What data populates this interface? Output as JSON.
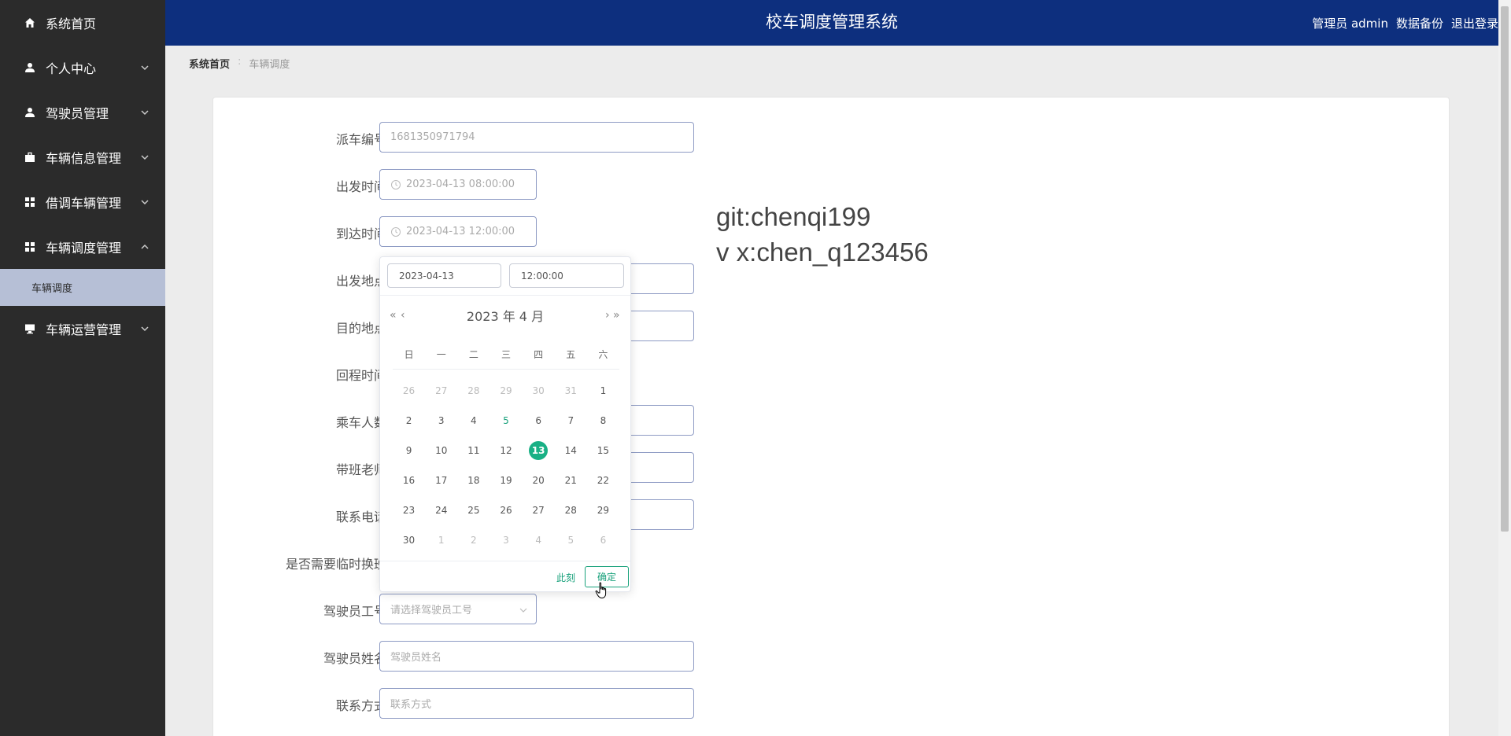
{
  "sidebar": {
    "items": [
      {
        "label": "系统首页",
        "icon": "home-icon"
      },
      {
        "label": "个人中心",
        "icon": "user-icon"
      },
      {
        "label": "驾驶员管理",
        "icon": "user-icon"
      },
      {
        "label": "车辆信息管理",
        "icon": "briefcase-icon"
      },
      {
        "label": "借调车辆管理",
        "icon": "grid-icon"
      },
      {
        "label": "车辆调度管理",
        "icon": "grid-icon"
      },
      {
        "label": "车辆运营管理",
        "icon": "monitor-icon"
      }
    ],
    "submenu": {
      "label": "车辆调度"
    }
  },
  "header": {
    "title": "校车调度管理系统",
    "user": "管理员 admin",
    "backup": "数据备份",
    "logout": "退出登录"
  },
  "breadcrumb": {
    "home": "系统首页",
    "separator": ":",
    "current": "车辆调度"
  },
  "form": {
    "dispatch_no_label": "派车编号",
    "dispatch_no_value": "1681350971794",
    "depart_time_label": "出发时间",
    "depart_time_value": "2023-04-13 08:00:00",
    "arrive_time_label": "到达时间",
    "arrive_time_value": "2023-04-13 12:00:00",
    "depart_place_label": "出发地点",
    "dest_label": "目的地点",
    "return_time_label": "回程时间",
    "passengers_label": "乘车人数",
    "teacher_label": "带班老师",
    "phone_label": "联系电话",
    "shift_label": "是否需要临时换班",
    "driver_id_label": "驾驶员工号",
    "driver_id_placeholder": "请选择驾驶员工号",
    "driver_name_label": "驾驶员姓名",
    "driver_name_placeholder": "驾驶员姓名",
    "contact_label": "联系方式",
    "contact_placeholder": "联系方式"
  },
  "watermark": {
    "line1": "git:chenqi199",
    "line2": "v x:chen_q123456"
  },
  "picker": {
    "date_value": "2023-04-13",
    "time_value": "12:00:00",
    "header": "2023 年  4 月",
    "prev_year": "«",
    "prev_month": "‹",
    "next_month": "›",
    "next_year": "»",
    "weekdays": [
      "日",
      "一",
      "二",
      "三",
      "四",
      "五",
      "六"
    ],
    "weeks": [
      [
        "26",
        "27",
        "28",
        "29",
        "30",
        "31",
        "1"
      ],
      [
        "2",
        "3",
        "4",
        "5",
        "6",
        "7",
        "8"
      ],
      [
        "9",
        "10",
        "11",
        "12",
        "13",
        "14",
        "15"
      ],
      [
        "16",
        "17",
        "18",
        "19",
        "20",
        "21",
        "22"
      ],
      [
        "23",
        "24",
        "25",
        "26",
        "27",
        "28",
        "29"
      ],
      [
        "30",
        "1",
        "2",
        "3",
        "4",
        "5",
        "6"
      ]
    ],
    "today": "5",
    "selected": "13",
    "now_label": "此刻",
    "ok_label": "确定",
    "accent": "#19b085"
  },
  "colors": {
    "sidebar_bg": "#2b2b2b",
    "header_bg": "#0d2f7e",
    "submenu_bg": "#b6bfd6"
  }
}
